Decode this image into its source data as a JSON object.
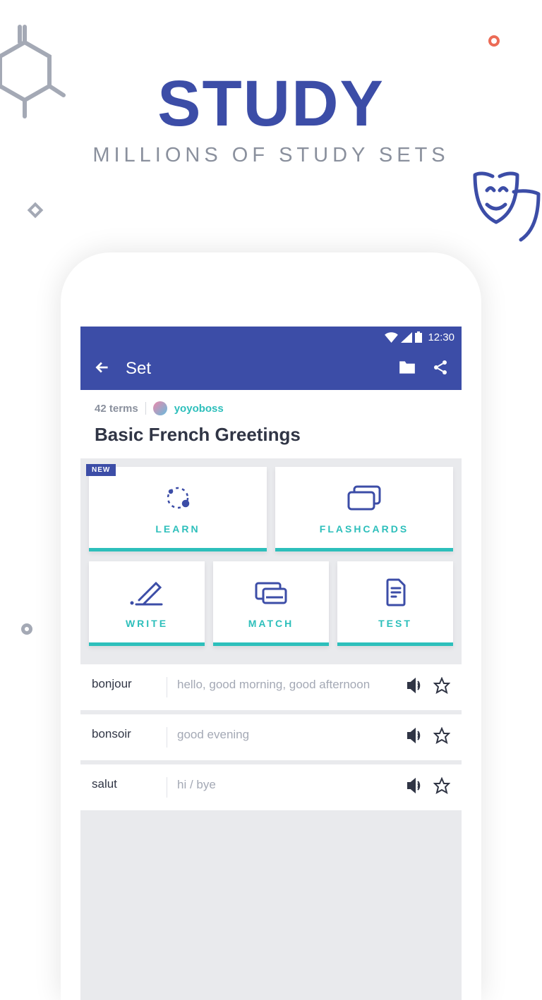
{
  "headline": {
    "big": "STUDY",
    "sub": "MILLIONS OF STUDY SETS"
  },
  "statusbar": {
    "time": "12:30"
  },
  "appbar": {
    "title": "Set"
  },
  "set": {
    "term_count": "42 terms",
    "username": "yoyoboss",
    "title": "Basic French Greetings"
  },
  "modes": {
    "learn": {
      "label": "LEARN",
      "badge": "NEW"
    },
    "flashcards": {
      "label": "FLASHCARDS"
    },
    "write": {
      "label": "WRITE"
    },
    "match": {
      "label": "MATCH"
    },
    "test": {
      "label": "TEST"
    }
  },
  "terms": [
    {
      "word": "bonjour",
      "definition": "hello, good morning, good afternoon"
    },
    {
      "word": "bonsoir",
      "definition": "good evening"
    },
    {
      "word": "salut",
      "definition": "hi / bye"
    }
  ],
  "colors": {
    "primary": "#3c4da7",
    "accent": "#2dbfbb",
    "grey": "#8a909d",
    "textdark": "#303545"
  }
}
